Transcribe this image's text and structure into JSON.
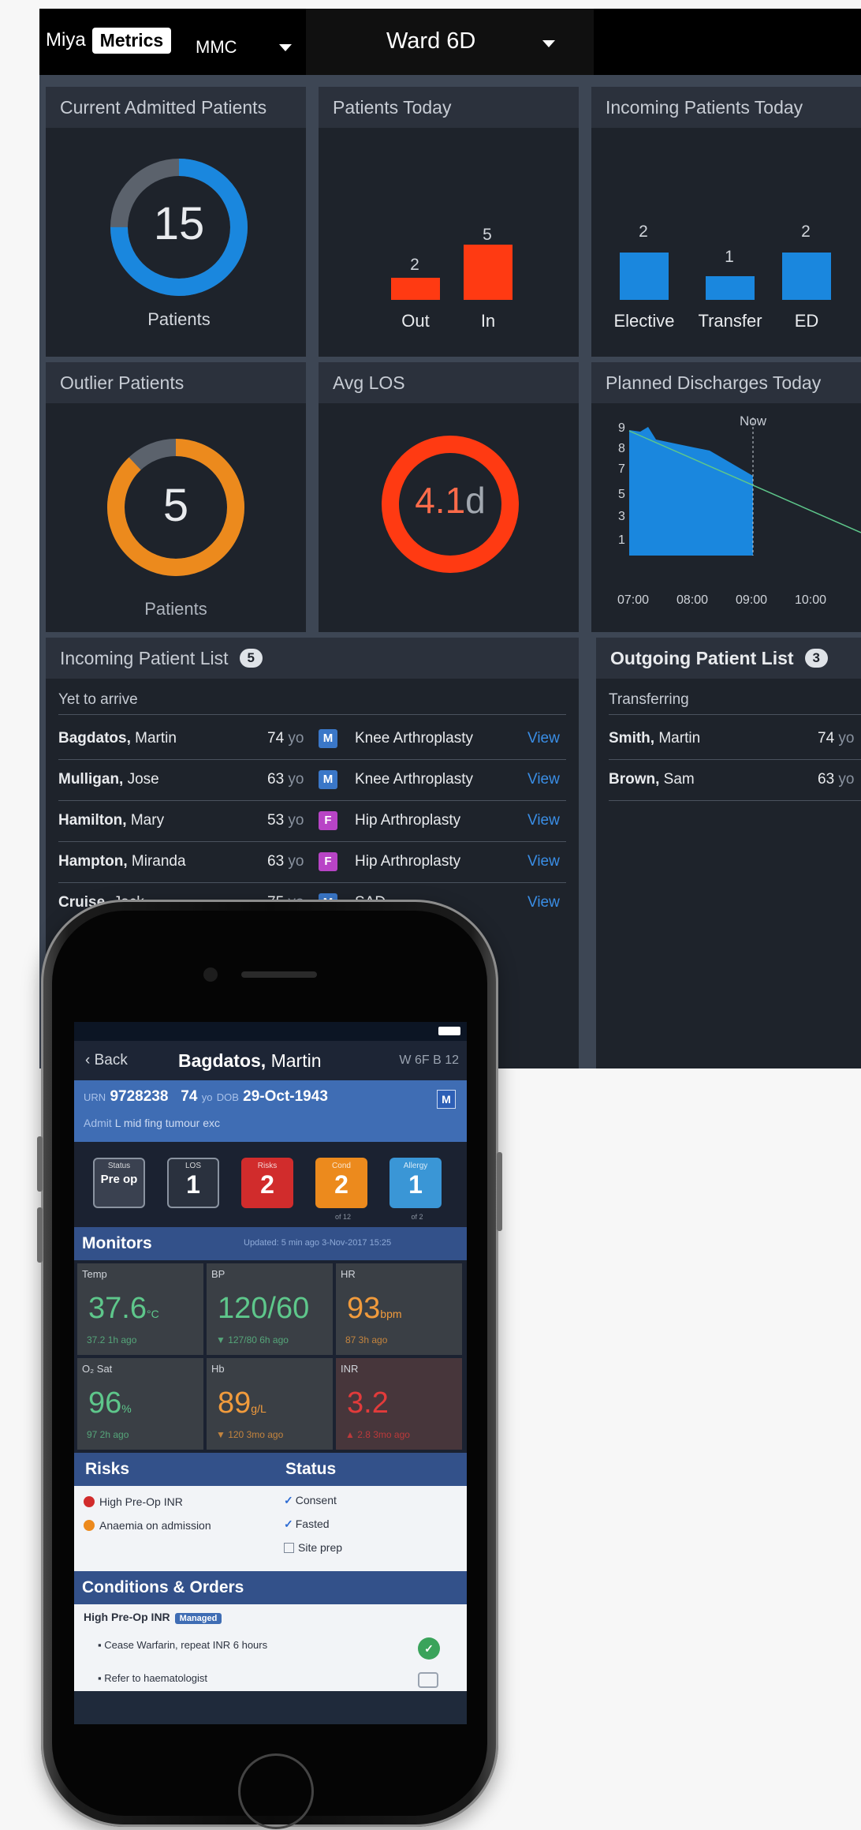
{
  "topbar": {
    "brand_prefix": "Miya",
    "brand_name": "Metrics",
    "org": "MMC",
    "ward": "Ward 6D"
  },
  "cards": {
    "admitted": {
      "title": "Current Admitted Patients",
      "value": "15",
      "label": "Patients",
      "fraction": 0.75
    },
    "today": {
      "title": "Patients Today",
      "bars": [
        {
          "label": "Out",
          "value": 2
        },
        {
          "label": "In",
          "value": 5
        }
      ]
    },
    "incoming_today": {
      "title": "Incoming Patients Today",
      "bars": [
        {
          "label": "Elective",
          "value": 2
        },
        {
          "label": "Transfer",
          "value": 1
        },
        {
          "label": "ED",
          "value": 2
        }
      ]
    },
    "outliers": {
      "title": "Outlier Patients",
      "value": "5",
      "label": "Patients",
      "fraction": 0.88
    },
    "avg_los": {
      "title": "Avg LOS",
      "value": "4.1",
      "unit": "d"
    },
    "planned": {
      "title": "Planned Discharges Today",
      "now_label": "Now"
    }
  },
  "chart_data": {
    "type": "area",
    "title": "Planned Discharges Today",
    "x": [
      "07:00",
      "08:00",
      "09:00",
      "10:00"
    ],
    "y_ticks": [
      9,
      8,
      7,
      5,
      3,
      1
    ],
    "series": [
      {
        "values": [
          9,
          8,
          7
        ]
      }
    ],
    "annotation": "Now"
  },
  "incoming_list": {
    "title": "Incoming Patient List",
    "count": "5",
    "section": "Yet to arrive",
    "rows": [
      {
        "last": "Bagdatos,",
        "first": "Martin",
        "age": "74",
        "sex": "M",
        "procedure": "Knee Arthroplasty",
        "action": "View"
      },
      {
        "last": "Mulligan,",
        "first": "Jose",
        "age": "63",
        "sex": "M",
        "procedure": "Knee Arthroplasty",
        "action": "View"
      },
      {
        "last": "Hamilton,",
        "first": "Mary",
        "age": "53",
        "sex": "F",
        "procedure": "Hip Arthroplasty",
        "action": "View"
      },
      {
        "last": "Hampton,",
        "first": "Miranda",
        "age": "63",
        "sex": "F",
        "procedure": "Hip Arthroplasty",
        "action": "View"
      },
      {
        "last": "Cruise,",
        "first": "Jack",
        "age": "75",
        "sex": "M",
        "procedure": "SAD",
        "action": "View"
      }
    ],
    "age_unit": "yo"
  },
  "outgoing_list": {
    "title": "Outgoing Patient List",
    "count": "3",
    "section": "Transferring",
    "rows": [
      {
        "last": "Smith,",
        "first": "Martin",
        "age": "74"
      },
      {
        "last": "Brown,",
        "first": "Sam",
        "age": "63"
      }
    ],
    "age_unit": "yo"
  },
  "colors": {
    "blue": "#1a87de",
    "red_orange": "#ff3a12",
    "orange": "#ec8a1d",
    "male": "#3a77c8",
    "female": "#b844c6"
  },
  "phone": {
    "status": {
      "title": "Status",
      "items": [
        {
          "text": "Consent",
          "checked": true
        },
        {
          "text": "Fasted",
          "checked": true
        },
        {
          "text": "Site prep",
          "checked": false
        }
      ]
    },
    "nav": {
      "back": "Back",
      "last": "Bagdatos,",
      "first": "Martin",
      "bed": "W 6F B 12"
    },
    "id": {
      "urn_label": "URN",
      "urn": "9728238",
      "age": "74",
      "age_unit": "yo",
      "dob_label": "DOB",
      "dob": "29-Oct-1943",
      "sex": "M",
      "admit_label": "Admit",
      "admit": "L mid fing tumour exc"
    },
    "tiles": [
      {
        "label": "Status",
        "value": "Pre op",
        "color": "#3a4150",
        "note": ""
      },
      {
        "label": "LOS",
        "value": "1",
        "color": "#2a313e",
        "note": ""
      },
      {
        "label": "Risks",
        "value": "2",
        "color": "#d12c2c",
        "note": ""
      },
      {
        "label": "Cond",
        "value": "2",
        "color": "#ec8a1d",
        "note": "of 12"
      },
      {
        "label": "Allergy",
        "value": "1",
        "color": "#3a96d6",
        "note": "of 2"
      }
    ],
    "monitors": {
      "title": "Monitors",
      "updated": "Updated: 5 min ago  3-Nov-2017 15:25",
      "cells": [
        {
          "name": "Temp",
          "value": "37.6",
          "unit": "°C",
          "prev": "37.2 1h ago",
          "tone": "green"
        },
        {
          "name": "BP",
          "value": "120/60",
          "unit": "",
          "prev": "▼ 127/80 6h ago",
          "tone": "green"
        },
        {
          "name": "HR",
          "value": "93",
          "unit": "bpm",
          "prev": "87 3h ago",
          "tone": "orange"
        },
        {
          "name": "O₂ Sat",
          "value": "96",
          "unit": "%",
          "prev": "97 2h ago",
          "tone": "green"
        },
        {
          "name": "Hb",
          "value": "89",
          "unit": "g/L",
          "prev": "▼ 120 3mo ago",
          "tone": "orange"
        },
        {
          "name": "INR",
          "value": "3.2",
          "unit": "",
          "prev": "▲ 2.8 3mo ago",
          "tone": "red"
        }
      ]
    },
    "risks": {
      "title": "Risks",
      "items": [
        {
          "text": "High Pre-Op INR",
          "color": "#d12c2c"
        },
        {
          "text": "Anaemia on admission",
          "color": "#ec8a1d"
        }
      ]
    },
    "conditions": {
      "title": "Conditions & Orders",
      "item": "High Pre-Op INR",
      "tag": "Managed",
      "orders": [
        "Cease Warfarin, repeat INR 6 hours",
        "Refer to haematologist"
      ]
    }
  }
}
